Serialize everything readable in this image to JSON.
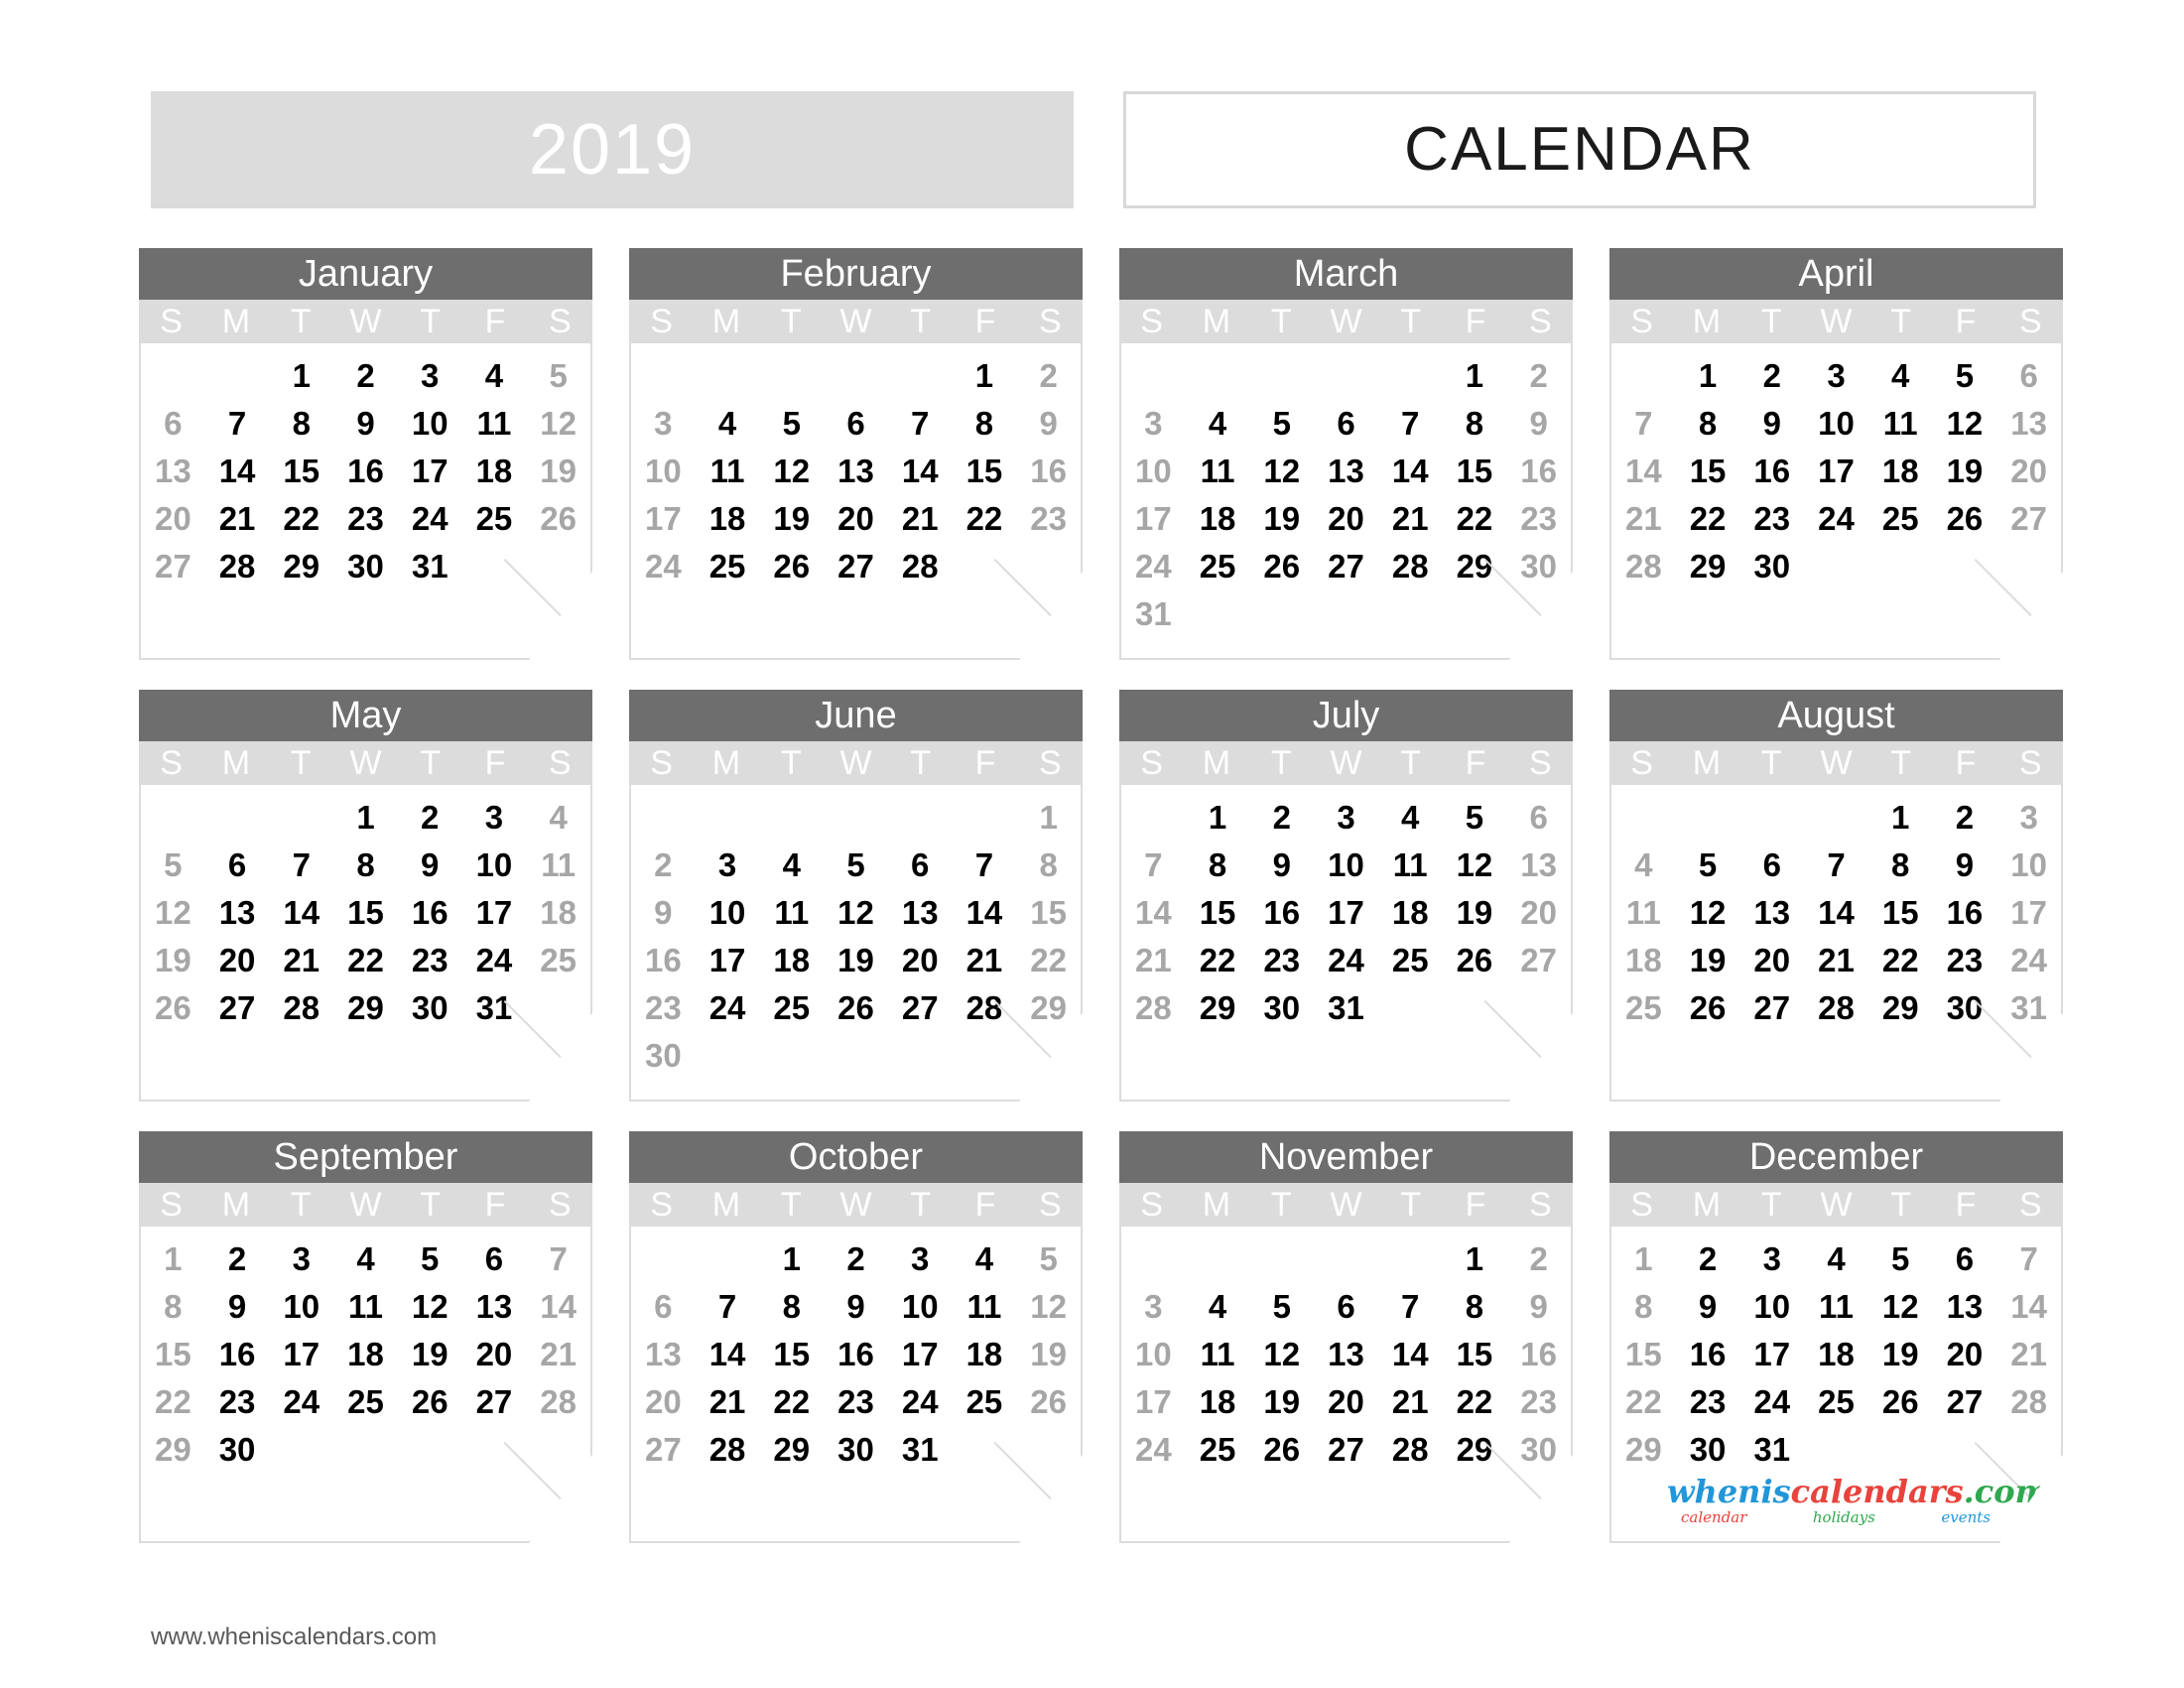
{
  "header": {
    "year": "2019",
    "title": "CALENDAR"
  },
  "footer": {
    "url": "www.wheniscalendars.com"
  },
  "logo": {
    "part1": "whenis",
    "part2": "calendars",
    "part3": ".com",
    "sub1": "calendar",
    "sub2": "holidays",
    "sub3": "events",
    "color1": "#2196d8",
    "color2": "#e8433c",
    "color3": "#2fa84f"
  },
  "theme": {
    "month_header_bg": "#6e6e6e",
    "dow_bg": "#dcdcdc",
    "year_box_bg": "#dcdcdc",
    "weekday_color": "#000000",
    "weekend_color": "#a6a6a6",
    "border_color": "#dcdcdc"
  },
  "weekday_labels": [
    "S",
    "M",
    "T",
    "W",
    "T",
    "F",
    "S"
  ],
  "months": [
    {
      "name": "January",
      "weeks": [
        [
          "",
          "",
          "1",
          "2",
          "3",
          "4",
          "5"
        ],
        [
          "6",
          "7",
          "8",
          "9",
          "10",
          "11",
          "12"
        ],
        [
          "13",
          "14",
          "15",
          "16",
          "17",
          "18",
          "19"
        ],
        [
          "20",
          "21",
          "22",
          "23",
          "24",
          "25",
          "26"
        ],
        [
          "27",
          "28",
          "29",
          "30",
          "31",
          "",
          ""
        ]
      ]
    },
    {
      "name": "February",
      "weeks": [
        [
          "",
          "",
          "",
          "",
          "",
          "1",
          "2"
        ],
        [
          "3",
          "4",
          "5",
          "6",
          "7",
          "8",
          "9"
        ],
        [
          "10",
          "11",
          "12",
          "13",
          "14",
          "15",
          "16"
        ],
        [
          "17",
          "18",
          "19",
          "20",
          "21",
          "22",
          "23"
        ],
        [
          "24",
          "25",
          "26",
          "27",
          "28",
          "",
          ""
        ]
      ]
    },
    {
      "name": "March",
      "weeks": [
        [
          "",
          "",
          "",
          "",
          "",
          "1",
          "2"
        ],
        [
          "3",
          "4",
          "5",
          "6",
          "7",
          "8",
          "9"
        ],
        [
          "10",
          "11",
          "12",
          "13",
          "14",
          "15",
          "16"
        ],
        [
          "17",
          "18",
          "19",
          "20",
          "21",
          "22",
          "23"
        ],
        [
          "24",
          "25",
          "26",
          "27",
          "28",
          "29",
          "30"
        ],
        [
          "31",
          "",
          "",
          "",
          "",
          "",
          ""
        ]
      ]
    },
    {
      "name": "April",
      "weeks": [
        [
          "",
          "1",
          "2",
          "3",
          "4",
          "5",
          "6"
        ],
        [
          "7",
          "8",
          "9",
          "10",
          "11",
          "12",
          "13"
        ],
        [
          "14",
          "15",
          "16",
          "17",
          "18",
          "19",
          "20"
        ],
        [
          "21",
          "22",
          "23",
          "24",
          "25",
          "26",
          "27"
        ],
        [
          "28",
          "29",
          "30",
          "",
          "",
          "",
          ""
        ]
      ]
    },
    {
      "name": "May",
      "weeks": [
        [
          "",
          "",
          "",
          "1",
          "2",
          "3",
          "4"
        ],
        [
          "5",
          "6",
          "7",
          "8",
          "9",
          "10",
          "11"
        ],
        [
          "12",
          "13",
          "14",
          "15",
          "16",
          "17",
          "18"
        ],
        [
          "19",
          "20",
          "21",
          "22",
          "23",
          "24",
          "25"
        ],
        [
          "26",
          "27",
          "28",
          "29",
          "30",
          "31",
          ""
        ]
      ]
    },
    {
      "name": "June",
      "weeks": [
        [
          "",
          "",
          "",
          "",
          "",
          "",
          "1"
        ],
        [
          "2",
          "3",
          "4",
          "5",
          "6",
          "7",
          "8"
        ],
        [
          "9",
          "10",
          "11",
          "12",
          "13",
          "14",
          "15"
        ],
        [
          "16",
          "17",
          "18",
          "19",
          "20",
          "21",
          "22"
        ],
        [
          "23",
          "24",
          "25",
          "26",
          "27",
          "28",
          "29"
        ],
        [
          "30",
          "",
          "",
          "",
          "",
          "",
          ""
        ]
      ]
    },
    {
      "name": "July",
      "weeks": [
        [
          "",
          "1",
          "2",
          "3",
          "4",
          "5",
          "6"
        ],
        [
          "7",
          "8",
          "9",
          "10",
          "11",
          "12",
          "13"
        ],
        [
          "14",
          "15",
          "16",
          "17",
          "18",
          "19",
          "20"
        ],
        [
          "21",
          "22",
          "23",
          "24",
          "25",
          "26",
          "27"
        ],
        [
          "28",
          "29",
          "30",
          "31",
          "",
          "",
          ""
        ]
      ]
    },
    {
      "name": "August",
      "weeks": [
        [
          "",
          "",
          "",
          "",
          "1",
          "2",
          "3"
        ],
        [
          "4",
          "5",
          "6",
          "7",
          "8",
          "9",
          "10"
        ],
        [
          "11",
          "12",
          "13",
          "14",
          "15",
          "16",
          "17"
        ],
        [
          "18",
          "19",
          "20",
          "21",
          "22",
          "23",
          "24"
        ],
        [
          "25",
          "26",
          "27",
          "28",
          "29",
          "30",
          "31"
        ]
      ]
    },
    {
      "name": "September",
      "weeks": [
        [
          "1",
          "2",
          "3",
          "4",
          "5",
          "6",
          "7"
        ],
        [
          "8",
          "9",
          "10",
          "11",
          "12",
          "13",
          "14"
        ],
        [
          "15",
          "16",
          "17",
          "18",
          "19",
          "20",
          "21"
        ],
        [
          "22",
          "23",
          "24",
          "25",
          "26",
          "27",
          "28"
        ],
        [
          "29",
          "30",
          "",
          "",
          "",
          "",
          ""
        ]
      ]
    },
    {
      "name": "October",
      "weeks": [
        [
          "",
          "",
          "1",
          "2",
          "3",
          "4",
          "5"
        ],
        [
          "6",
          "7",
          "8",
          "9",
          "10",
          "11",
          "12"
        ],
        [
          "13",
          "14",
          "15",
          "16",
          "17",
          "18",
          "19"
        ],
        [
          "20",
          "21",
          "22",
          "23",
          "24",
          "25",
          "26"
        ],
        [
          "27",
          "28",
          "29",
          "30",
          "31",
          "",
          ""
        ]
      ]
    },
    {
      "name": "November",
      "weeks": [
        [
          "",
          "",
          "",
          "",
          "",
          "1",
          "2"
        ],
        [
          "3",
          "4",
          "5",
          "6",
          "7",
          "8",
          "9"
        ],
        [
          "10",
          "11",
          "12",
          "13",
          "14",
          "15",
          "16"
        ],
        [
          "17",
          "18",
          "19",
          "20",
          "21",
          "22",
          "23"
        ],
        [
          "24",
          "25",
          "26",
          "27",
          "28",
          "29",
          "30"
        ]
      ]
    },
    {
      "name": "December",
      "weeks": [
        [
          "1",
          "2",
          "3",
          "4",
          "5",
          "6",
          "7"
        ],
        [
          "8",
          "9",
          "10",
          "11",
          "12",
          "13",
          "14"
        ],
        [
          "15",
          "16",
          "17",
          "18",
          "19",
          "20",
          "21"
        ],
        [
          "22",
          "23",
          "24",
          "25",
          "26",
          "27",
          "28"
        ],
        [
          "29",
          "30",
          "31",
          "",
          "",
          "",
          ""
        ]
      ]
    }
  ]
}
